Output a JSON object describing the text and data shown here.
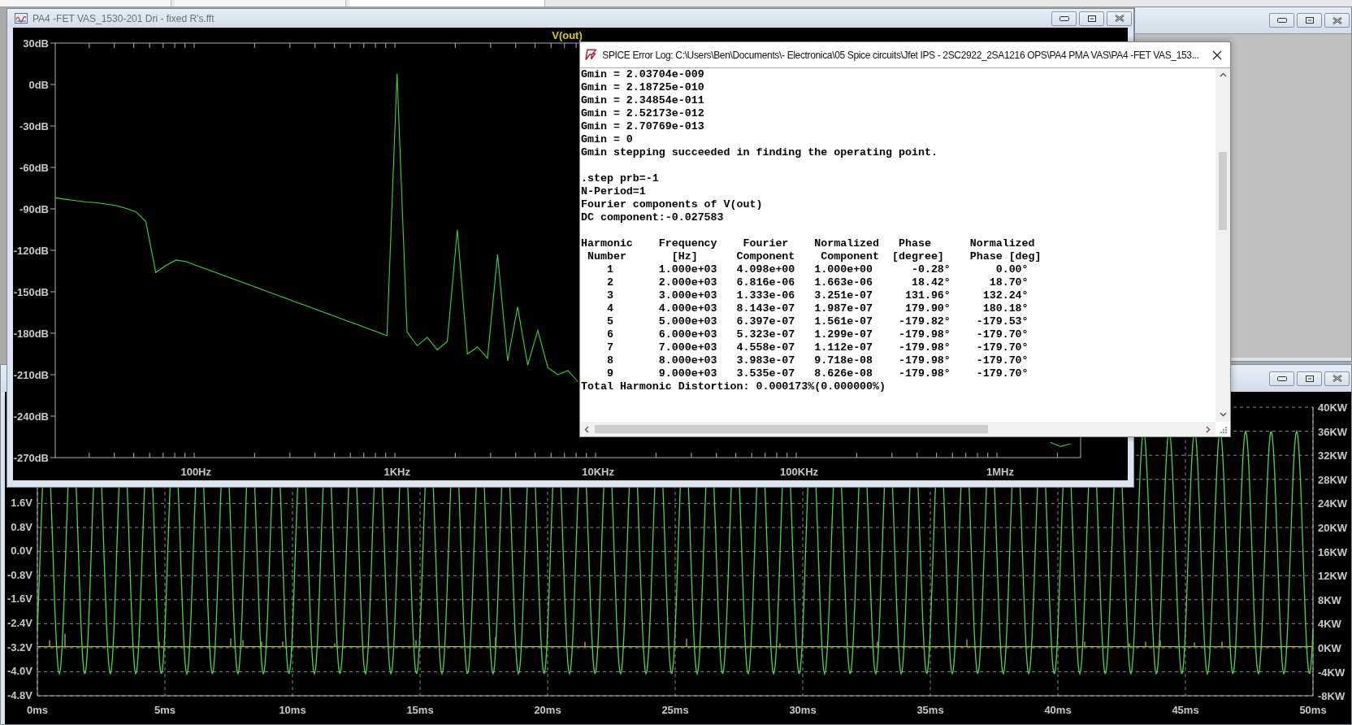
{
  "fft_window": {
    "title": "PA4 -FET VAS_1530-201 Dri - fixed R's.fft",
    "chart_data": {
      "type": "line",
      "categories": [
        null,
        null,
        null,
        null,
        null,
        null,
        null,
        null,
        null,
        null,
        null,
        null,
        null,
        null,
        "100Hz",
        null,
        null,
        null,
        null,
        null,
        null,
        null,
        null,
        null,
        null,
        null,
        null,
        null,
        null,
        null,
        null,
        null,
        null,
        null,
        "1KHz",
        null,
        null,
        null,
        null,
        null,
        null,
        null,
        null,
        null,
        null,
        null,
        null,
        null,
        null,
        null,
        null,
        null,
        null,
        null,
        "10KHz",
        null,
        null,
        null,
        null,
        null,
        null,
        null,
        null,
        null,
        null,
        null,
        null,
        null,
        null,
        null,
        null,
        null,
        null,
        null,
        "100KHz",
        null,
        null,
        null,
        null,
        null,
        null,
        null,
        null,
        null,
        null,
        null,
        null,
        null,
        null,
        null,
        null,
        null,
        null,
        null,
        "1MHz",
        null,
        null,
        null,
        null,
        null,
        null,
        null,
        null
      ],
      "series": [
        {
          "name": "V(out)",
          "values": [
            -82,
            -83,
            -84,
            -85,
            -85.5,
            -86.5,
            -87.5,
            -89.5,
            -92,
            -99,
            -136,
            -131,
            -127,
            -128.1,
            -130.8,
            -133.5,
            -136.1,
            -138.8,
            -141.5,
            -144.2,
            -146.8,
            -149.5,
            -152.2,
            -154.9,
            -157.6,
            -160.2,
            -162.9,
            -165.6,
            -168.3,
            -171,
            -173.6,
            -176.3,
            -179,
            -181.7,
            8,
            -179,
            -189,
            -183,
            -192,
            -186,
            -105,
            -195,
            -190,
            -198,
            -123,
            -200,
            -161,
            -203,
            -178,
            -205,
            -210,
            -207,
            -215,
            null,
            null,
            null,
            null,
            null,
            null,
            null,
            null,
            null,
            null,
            null,
            null,
            null,
            null,
            null,
            null,
            null,
            null,
            null,
            null,
            null,
            null,
            null,
            null,
            null,
            null,
            null,
            null,
            null,
            null,
            null,
            null,
            null,
            null,
            null,
            null,
            null,
            null,
            null,
            null,
            null,
            null,
            null,
            null,
            null,
            null,
            -259,
            -262,
            -260,
            null
          ]
        }
      ],
      "ylim": [
        -270,
        30
      ],
      "yticks": [
        {
          "value": 30,
          "label": "30dB"
        },
        {
          "value": 0,
          "label": "0dB"
        },
        {
          "value": -30,
          "label": "-30dB"
        },
        {
          "value": -60,
          "label": "-60dB"
        },
        {
          "value": -90,
          "label": "-90dB"
        },
        {
          "value": -120,
          "label": "-120dB"
        },
        {
          "value": -150,
          "label": "-150dB"
        },
        {
          "value": -180,
          "label": "-180dB"
        },
        {
          "value": -210,
          "label": "-210dB"
        },
        {
          "value": -240,
          "label": "-240dB"
        },
        {
          "value": -270,
          "label": "-270dB"
        }
      ]
    }
  },
  "log_dialog": {
    "title": "SPICE Error Log: C:\\Users\\Ben\\Documents\\- Electronica\\05 Spice circuits\\Jfet IPS - 2SC2922_2SA1216 OPS\\PA4 PMA VAS\\PA4 -FET VAS_153...",
    "blocks": [
      [
        "Gmin = 2.03704e-009",
        "Gmin = 2.18725e-010",
        "Gmin = 2.34854e-011",
        "Gmin = 2.52173e-012",
        "Gmin = 2.70769e-013",
        "Gmin = 0",
        "Gmin stepping succeeded in finding the operating point."
      ],
      [
        ".step prb=-1",
        "N-Period=1",
        "Fourier components of V(out)",
        "DC component:-0.027583"
      ],
      [
        "Harmonic    Frequency    Fourier    Normalized   Phase      Normalized",
        " Number       [Hz]      Component    Component  [degree]    Phase [deg]",
        "    1       1.000e+03   4.098e+00   1.000e+00      -0.28°       0.00°",
        "    2       2.000e+03   6.816e-06   1.663e-06      18.42°      18.70°",
        "    3       3.000e+03   1.333e-06   3.251e-07     131.96°     132.24°",
        "    4       4.000e+03   8.143e-07   1.987e-07     179.90°     180.18°",
        "    5       5.000e+03   6.397e-07   1.561e-07    -179.82°    -179.53°",
        "    6       6.000e+03   5.323e-07   1.299e-07    -179.98°    -179.70°",
        "    7       7.000e+03   4.558e-07   1.112e-07    -179.98°    -179.70°",
        "    8       8.000e+03   3.983e-07   9.718e-08    -179.98°    -179.70°",
        "    9       9.000e+03   3.535e-07   8.626e-08    -179.98°    -179.70°",
        "Total Harmonic Distortion: 0.000173%(0.000000%)"
      ]
    ]
  },
  "transient_window": {
    "left_ticks": [
      "1.6V",
      "0.8V",
      "0.0V",
      "-0.8V",
      "-1.6V",
      "-2.4V",
      "-3.2V",
      "-4.0V",
      "-4.8V"
    ],
    "right_ticks": [
      "40KW",
      "36KW",
      "32KW",
      "28KW",
      "24KW",
      "20KW",
      "16KW",
      "12KW",
      "8KW",
      "4KW",
      "0KW",
      "-4KW",
      "-8KW"
    ],
    "x_ticks": [
      "0ms",
      "5ms",
      "10ms",
      "15ms",
      "20ms",
      "25ms",
      "30ms",
      "35ms",
      "40ms",
      "45ms",
      "50ms"
    ]
  }
}
